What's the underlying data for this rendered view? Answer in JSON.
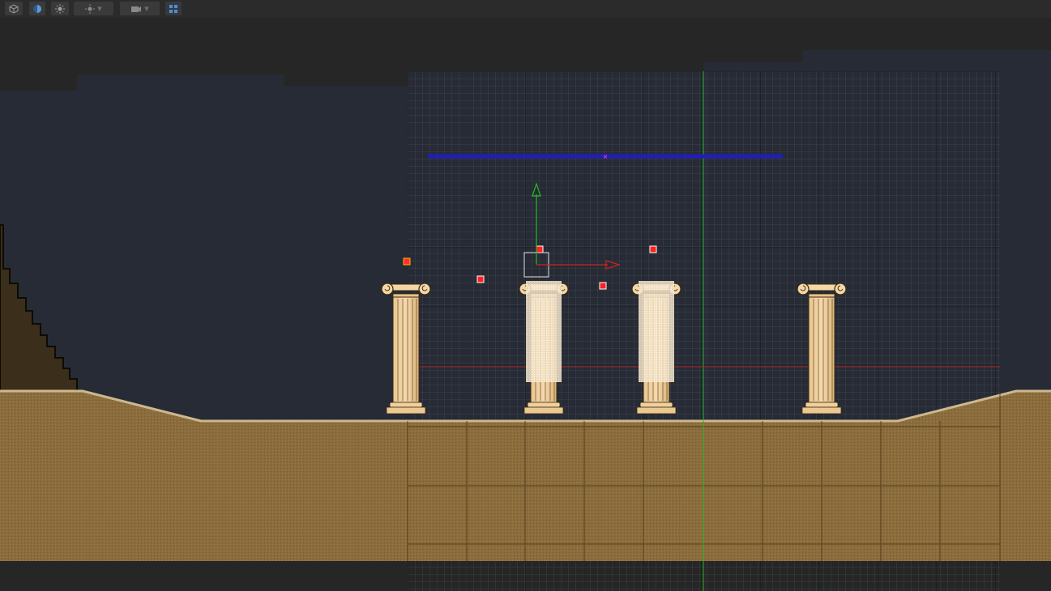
{
  "toolbar": {
    "buttons": [
      {
        "name": "view-mode-3d-button",
        "icon": "cube-icon"
      },
      {
        "name": "render-mode-button",
        "icon": "half-circle-icon"
      },
      {
        "name": "lighting-toggle-button",
        "icon": "sun-icon"
      },
      {
        "name": "lighting-dropdown",
        "icon": "sun-icon"
      },
      {
        "name": "camera-dropdown",
        "icon": "camera-icon"
      },
      {
        "name": "grid-toggle-button",
        "icon": "grid-icon"
      }
    ]
  },
  "scene": {
    "colors": {
      "background_far": "#272b35",
      "dark_band": "#262626",
      "ground": "#8a6c3c",
      "ground_edge": "#c9b48a",
      "column": "#f1cf9a",
      "column_highlight": "#f7e8cf",
      "grid_line": "#5a6270",
      "axis_y": "#22bb22",
      "axis_x": "#cc2222",
      "selection_bar": "#1f1fb8",
      "marker": "#ff2020"
    },
    "objects": [
      {
        "name": "ionic-column-1",
        "type": "column",
        "selected": false
      },
      {
        "name": "ionic-column-2",
        "type": "column",
        "selected": true
      },
      {
        "name": "ionic-column-3",
        "type": "column",
        "selected": true
      },
      {
        "name": "ionic-column-4",
        "type": "column",
        "selected": false
      },
      {
        "name": "ground-terrain",
        "type": "terrain"
      },
      {
        "name": "hillside-slope",
        "type": "terrain"
      }
    ],
    "gizmo": {
      "x_axis": "x-axis-arrow",
      "y_axis": "y-axis-arrow"
    }
  }
}
